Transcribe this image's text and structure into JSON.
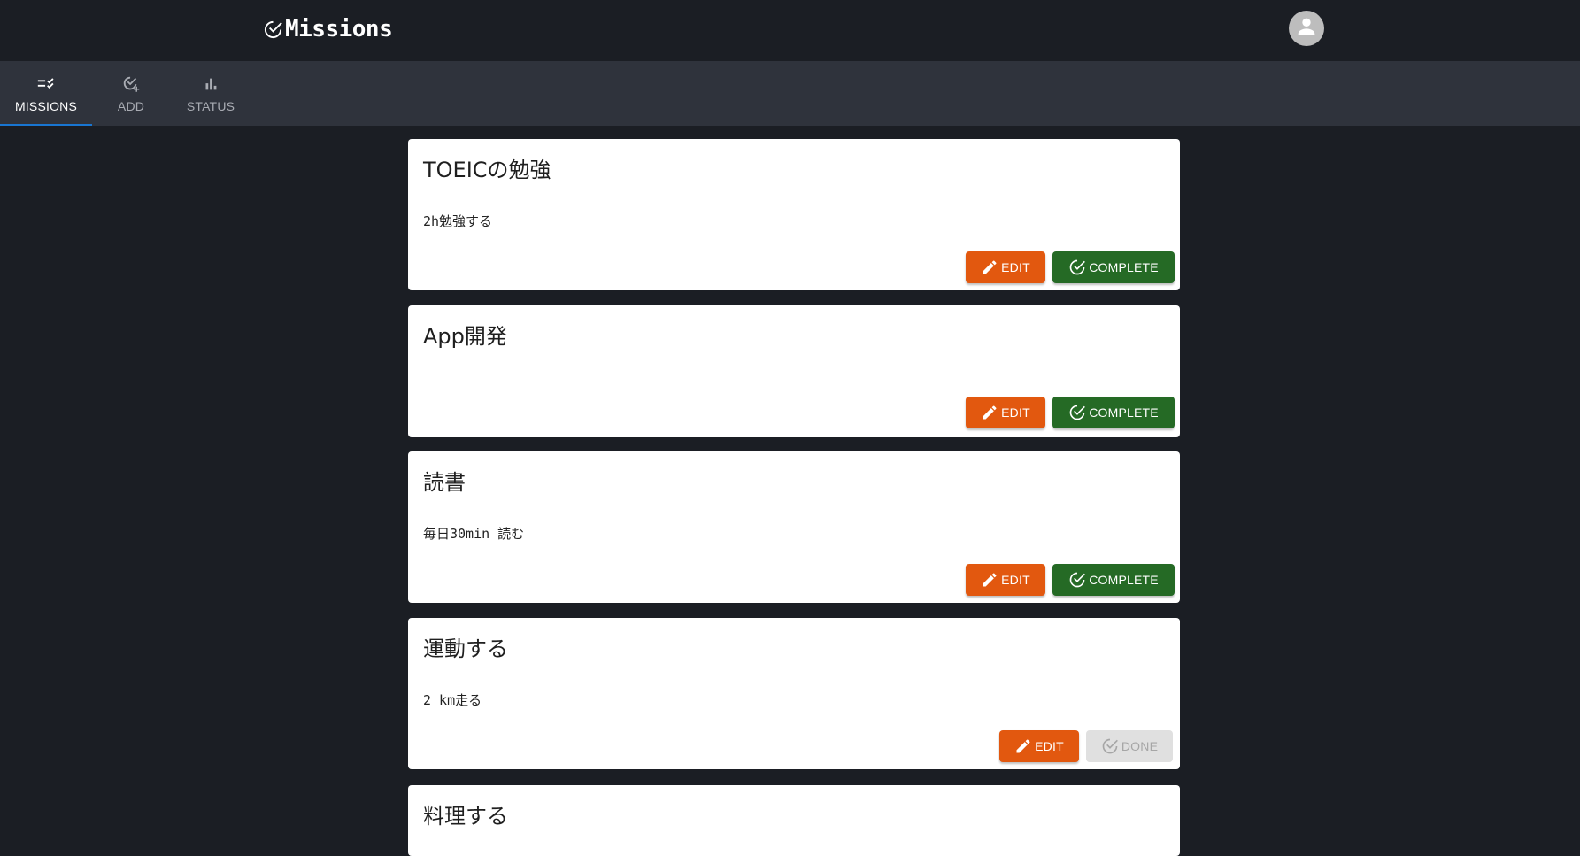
{
  "app": {
    "title": "Missions",
    "brand_icon": "check-circle-icon",
    "avatar_icon": "person-icon"
  },
  "tabs": [
    {
      "label": "MISSIONS",
      "icon": "checklist-icon",
      "active": true
    },
    {
      "label": "ADD",
      "icon": "add-task-icon",
      "active": false
    },
    {
      "label": "STATUS",
      "icon": "bar-chart-icon",
      "active": false
    }
  ],
  "colors": {
    "edit": "#e2580f",
    "complete": "#256a25",
    "done_disabled": "#e0e0e0",
    "tab_indicator": "#1976d2"
  },
  "missions": [
    {
      "title": "TOEICの勉強",
      "description": "2h勉強する",
      "edit_label": "EDIT",
      "action_label": "COMPLETE",
      "completed": false
    },
    {
      "title": "App開発",
      "description": "",
      "edit_label": "EDIT",
      "action_label": "COMPLETE",
      "completed": false
    },
    {
      "title": "読書",
      "description": "毎日30min 読む",
      "edit_label": "EDIT",
      "action_label": "COMPLETE",
      "completed": false
    },
    {
      "title": "運動する",
      "description": "2 km走る",
      "edit_label": "EDIT",
      "action_label": "DONE",
      "completed": true
    },
    {
      "title": "料理する",
      "description": "",
      "edit_label": "",
      "action_label": "",
      "completed": false
    }
  ]
}
